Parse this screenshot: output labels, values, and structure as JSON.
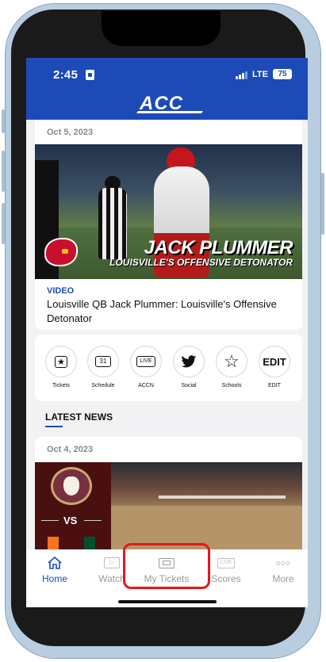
{
  "status_bar": {
    "time": "2:45",
    "network": "LTE",
    "battery": "75"
  },
  "header": {
    "logo_text": "ACC"
  },
  "feature_card": {
    "date": "Oct 5, 2023",
    "image_title": "JACK PLUMMER",
    "image_subtitle": "LOUISVILLE'S OFFENSIVE DETONATOR",
    "tag": "VIDEO",
    "headline": "Louisville QB Jack Plummer: Louisville's Offensive Detonator"
  },
  "quick_links": [
    {
      "label": "Tickets",
      "icon": "ticket-star-icon"
    },
    {
      "label": "Schedule",
      "icon": "calendar-icon",
      "icon_text": "31"
    },
    {
      "label": "ACCN",
      "icon": "live-tv-icon",
      "icon_text": "LIVE"
    },
    {
      "label": "Social",
      "icon": "twitter-bird-icon"
    },
    {
      "label": "Schools",
      "icon": "star-outline-icon"
    },
    {
      "label": "EDIT",
      "icon": "edit-text",
      "icon_text": "EDIT"
    }
  ],
  "latest_news": {
    "title": "LATEST NEWS",
    "card": {
      "date": "Oct 4, 2023",
      "vs_text": "VS"
    }
  },
  "bottom_nav": {
    "items": [
      {
        "label": "Home",
        "icon": "home-icon",
        "active": true
      },
      {
        "label": "Watch",
        "icon": "play-video-icon",
        "active": false
      },
      {
        "label": "My Tickets",
        "icon": "ticket-icon",
        "active": false
      },
      {
        "label": "Scores",
        "icon": "live-scores-icon",
        "icon_text": "LIVE",
        "active": false
      },
      {
        "label": "More",
        "icon": "more-dots-icon",
        "icon_text": "ooo",
        "active": false
      }
    ]
  },
  "colors": {
    "brand_blue": "#1c4bb8",
    "highlight_red": "#e8151b",
    "fsu_garnet": "#782f40"
  }
}
